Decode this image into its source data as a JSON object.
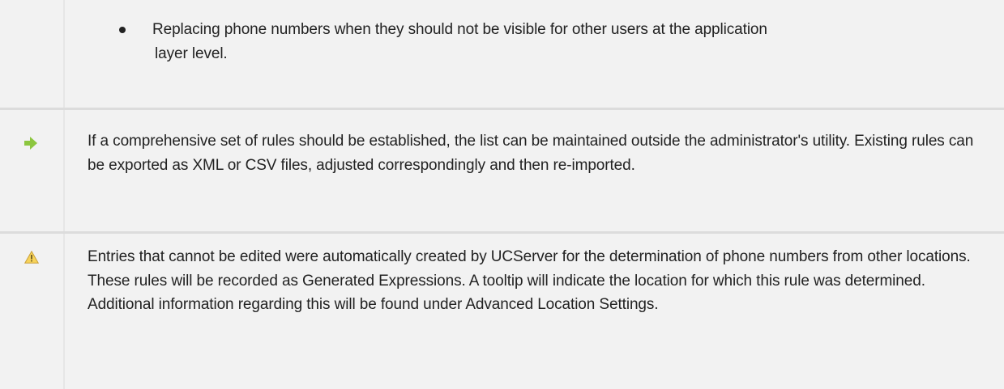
{
  "rows": {
    "bullet": {
      "text_line1": "Replacing phone numbers when they should not be visible for other users at the application",
      "text_line2": "layer level."
    },
    "tip": {
      "icon": "arrow-right-icon",
      "icon_color": "#8cc63f",
      "text": "If a comprehensive set of rules should be established, the list can be maintained outside the administrator's utility. Existing rules can be exported as XML or CSV files, adjusted correspondingly and then re-imported."
    },
    "warning": {
      "icon": "warning-triangle-icon",
      "icon_color": "#f0c33c",
      "text": "Entries that cannot be edited were automatically created by UCServer for the determination of phone numbers from other locations. These rules will be recorded as Generated Expressions. A tooltip will indicate the location for which this rule was determined. Additional information regarding this will be found under Advanced Location Settings."
    }
  },
  "colors": {
    "cell_background": "#f2f2f2",
    "divider": "#dcdcdc",
    "text": "#222222"
  }
}
